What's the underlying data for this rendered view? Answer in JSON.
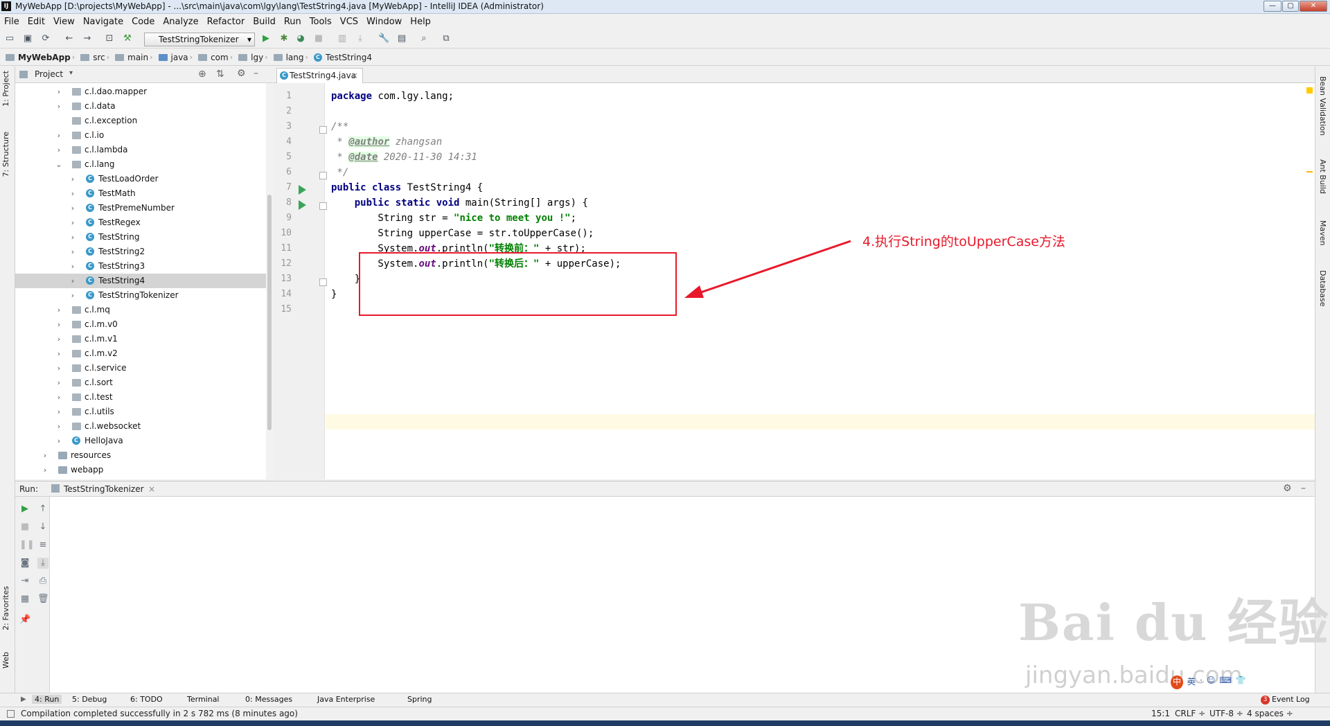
{
  "window": {
    "title": "MyWebApp [D:\\projects\\MyWebApp] - ...\\src\\main\\java\\com\\lgy\\lang\\TestString4.java [MyWebApp] - IntelliJ IDEA (Administrator)",
    "app_icon": "IJ",
    "min_glyph": "—",
    "max_glyph": "▢",
    "close_glyph": "✕"
  },
  "menu": [
    "File",
    "Edit",
    "View",
    "Navigate",
    "Code",
    "Analyze",
    "Refactor",
    "Build",
    "Run",
    "Tools",
    "VCS",
    "Window",
    "Help"
  ],
  "toolbar": {
    "run_config": "TestStringTokenizer",
    "dropdown_glyph": "▾"
  },
  "breadcrumb": [
    "MyWebApp",
    "src",
    "main",
    "java",
    "com",
    "lgy",
    "lang",
    "TestString4"
  ],
  "left_strip": {
    "project": "1: Project",
    "structure": "7: Structure",
    "favorites": "2: Favorites",
    "web": "Web"
  },
  "project_panel": {
    "title": "Project",
    "items": [
      {
        "label": "c.l.dao.mapper",
        "type": "pkg",
        "indent": 1,
        "arrow": "›"
      },
      {
        "label": "c.l.data",
        "type": "pkg",
        "indent": 1,
        "arrow": "›"
      },
      {
        "label": "c.l.exception",
        "type": "pkg",
        "indent": 1,
        "arrow": ""
      },
      {
        "label": "c.l.io",
        "type": "pkg",
        "indent": 1,
        "arrow": "›"
      },
      {
        "label": "c.l.lambda",
        "type": "pkg",
        "indent": 1,
        "arrow": "›"
      },
      {
        "label": "c.l.lang",
        "type": "pkg",
        "indent": 1,
        "arrow": "⌄"
      },
      {
        "label": "TestLoadOrder",
        "type": "cls",
        "indent": 2,
        "arrow": "›"
      },
      {
        "label": "TestMath",
        "type": "cls",
        "indent": 2,
        "arrow": "›"
      },
      {
        "label": "TestPremeNumber",
        "type": "cls",
        "indent": 2,
        "arrow": "›"
      },
      {
        "label": "TestRegex",
        "type": "cls",
        "indent": 2,
        "arrow": "›"
      },
      {
        "label": "TestString",
        "type": "cls",
        "indent": 2,
        "arrow": "›"
      },
      {
        "label": "TestString2",
        "type": "cls",
        "indent": 2,
        "arrow": "›"
      },
      {
        "label": "TestString3",
        "type": "cls",
        "indent": 2,
        "arrow": "›"
      },
      {
        "label": "TestString4",
        "type": "cls",
        "indent": 2,
        "arrow": "›",
        "selected": true
      },
      {
        "label": "TestStringTokenizer",
        "type": "cls",
        "indent": 2,
        "arrow": "›"
      },
      {
        "label": "c.l.mq",
        "type": "pkg",
        "indent": 1,
        "arrow": "›"
      },
      {
        "label": "c.l.m.v0",
        "type": "pkg",
        "indent": 1,
        "arrow": "›"
      },
      {
        "label": "c.l.m.v1",
        "type": "pkg",
        "indent": 1,
        "arrow": "›"
      },
      {
        "label": "c.l.m.v2",
        "type": "pkg",
        "indent": 1,
        "arrow": "›"
      },
      {
        "label": "c.l.service",
        "type": "pkg",
        "indent": 1,
        "arrow": "›"
      },
      {
        "label": "c.l.sort",
        "type": "pkg",
        "indent": 1,
        "arrow": "›"
      },
      {
        "label": "c.l.test",
        "type": "pkg",
        "indent": 1,
        "arrow": "›"
      },
      {
        "label": "c.l.utils",
        "type": "pkg",
        "indent": 1,
        "arrow": "›"
      },
      {
        "label": "c.l.websocket",
        "type": "pkg",
        "indent": 1,
        "arrow": "›"
      },
      {
        "label": "HelloJava",
        "type": "cls",
        "indent": 1,
        "arrow": "›"
      },
      {
        "label": "resources",
        "type": "fld",
        "indent": 0,
        "arrow": "›"
      },
      {
        "label": "webapp",
        "type": "fld",
        "indent": 0,
        "arrow": "›"
      }
    ]
  },
  "editor": {
    "tab": "TestString4.java",
    "tab_close": "×",
    "line_numbers": [
      "1",
      "2",
      "3",
      "4",
      "5",
      "6",
      "7",
      "8",
      "9",
      "10",
      "11",
      "12",
      "13",
      "14",
      "15"
    ],
    "code": {
      "l1_kw": "package",
      "l1_rest": " com.lgy.lang;",
      "l3": "/**",
      "l4_star": " * ",
      "l4_tag": "@author",
      "l4_val": " zhangsan",
      "l5_star": " * ",
      "l5_tag": "@date",
      "l5_val": " 2020-11-30 14:31",
      "l6": " */",
      "l7_kw": "public class",
      "l7_rest": " TestString4 {",
      "l8_indent": "    ",
      "l8_kw": "public static void",
      "l8_rest": " main(String[] args) {",
      "l9_pre": "        String str = ",
      "l9_str": "\"nice to meet you !\"",
      "l9_post": ";",
      "l10": "        String upperCase = str.toUpperCase();",
      "l11_pre": "        System.",
      "l11_field": "out",
      "l11_mid": ".println(",
      "l11_str": "\"转换前：\"",
      "l11_post": " + str);",
      "l12_pre": "        System.",
      "l12_field": "out",
      "l12_mid": ".println(",
      "l12_str": "\"转换后：\"",
      "l12_post": " + upperCase);",
      "l13": "    }",
      "l14": "}"
    }
  },
  "annotation": {
    "text": "4.执行String的toUpperCase方法",
    "color": "#e8182a"
  },
  "right_strip": {
    "bean": "Bean Validation",
    "ant": "Ant Build",
    "maven": "Maven",
    "database": "Database"
  },
  "run_panel": {
    "label": "Run:",
    "tab": "TestStringTokenizer",
    "tab_close": "×"
  },
  "bottom_tabs": [
    "4: Run",
    "5: Debug",
    "6: TODO",
    "Terminal",
    "0: Messages",
    "Java Enterprise",
    "Spring"
  ],
  "event_log": {
    "count": "3",
    "label": "Event Log"
  },
  "status": {
    "message": "Compilation completed successfully in 2 s 782 ms (8 minutes ago)",
    "position": "15:1",
    "line_sep": "CRLF ÷",
    "encoding": "UTF-8 ÷",
    "indent": "4 spaces ÷"
  },
  "watermark": {
    "main": "Bai du 经验",
    "sub": "jingyan.baidu.com"
  },
  "ime": [
    "中",
    "英",
    "·",
    "☺",
    "⌨",
    "👕"
  ]
}
